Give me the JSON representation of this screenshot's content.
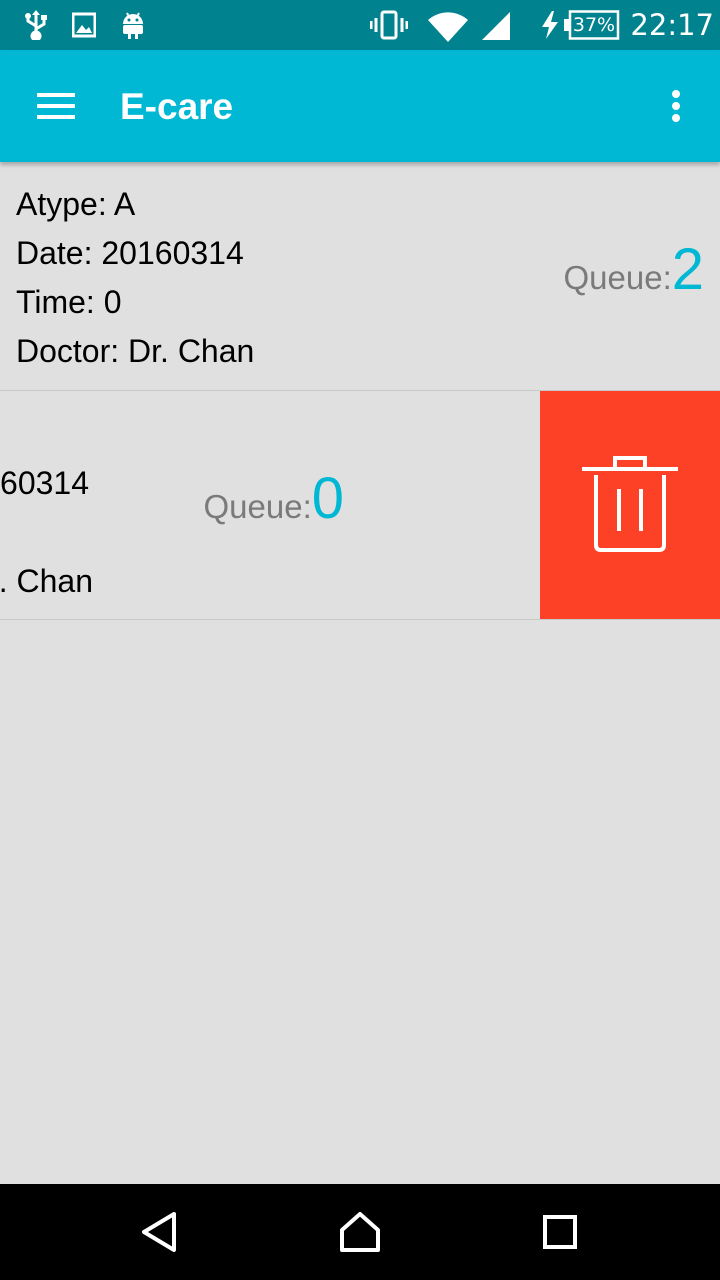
{
  "status_bar": {
    "left_icons": [
      "usb-icon",
      "image-icon",
      "android-icon"
    ],
    "right_icons": [
      "vibrate-icon",
      "wifi-icon",
      "signal-icon",
      "charging-icon",
      "battery-icon"
    ],
    "battery": "37%",
    "time": "22:17"
  },
  "toolbar": {
    "menu_icon": "hamburger-menu-icon",
    "title": "E-care",
    "overflow_icon": "more-vert-icon"
  },
  "appointments": [
    {
      "atype": "Atype: A",
      "date": "Date: 20160314",
      "time": "Time: 0",
      "doctor": "Doctor: Dr. Chan",
      "queue_label": "Queue:",
      "queue_value": "2"
    },
    {
      "date_partial": "60314",
      "doctor_partial": ". Chan",
      "queue_label": "Queue:",
      "queue_value": "0",
      "swipe_action_icon": "trash-icon"
    }
  ],
  "colors": {
    "status_bar": "#00838f",
    "toolbar": "#00b8d4",
    "accent": "#00b8d4",
    "delete_action": "#fc4127",
    "background": "#e0e0e0"
  },
  "nav_bar": {
    "icons": [
      "back-icon",
      "home-icon",
      "recents-icon"
    ]
  }
}
